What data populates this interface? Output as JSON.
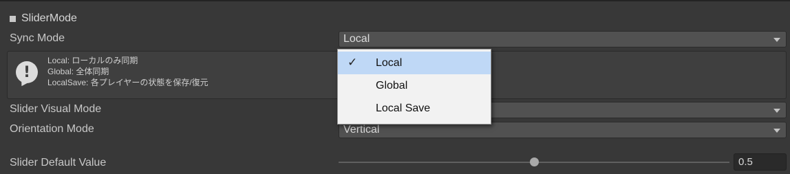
{
  "section": {
    "title": "SliderMode"
  },
  "sync_mode": {
    "label": "Sync Mode",
    "value": "Local"
  },
  "help": {
    "lines": [
      "Local: ローカルのみ同期",
      "Global: 全体同期",
      "LocalSave: 各プレイヤーの状態を保存/復元"
    ]
  },
  "slider_visual_mode": {
    "label": "Slider Visual Mode",
    "value": ""
  },
  "orientation_mode": {
    "label": "Orientation Mode",
    "value": "Vertical"
  },
  "slider_default": {
    "label": "Slider Default Value",
    "value": "0.5",
    "fraction": 0.5
  },
  "dropdown_menu": {
    "items": [
      {
        "label": "Local",
        "checked": true
      },
      {
        "label": "Global",
        "checked": false
      },
      {
        "label": "Local Save",
        "checked": false
      }
    ],
    "check_glyph": "✓"
  }
}
